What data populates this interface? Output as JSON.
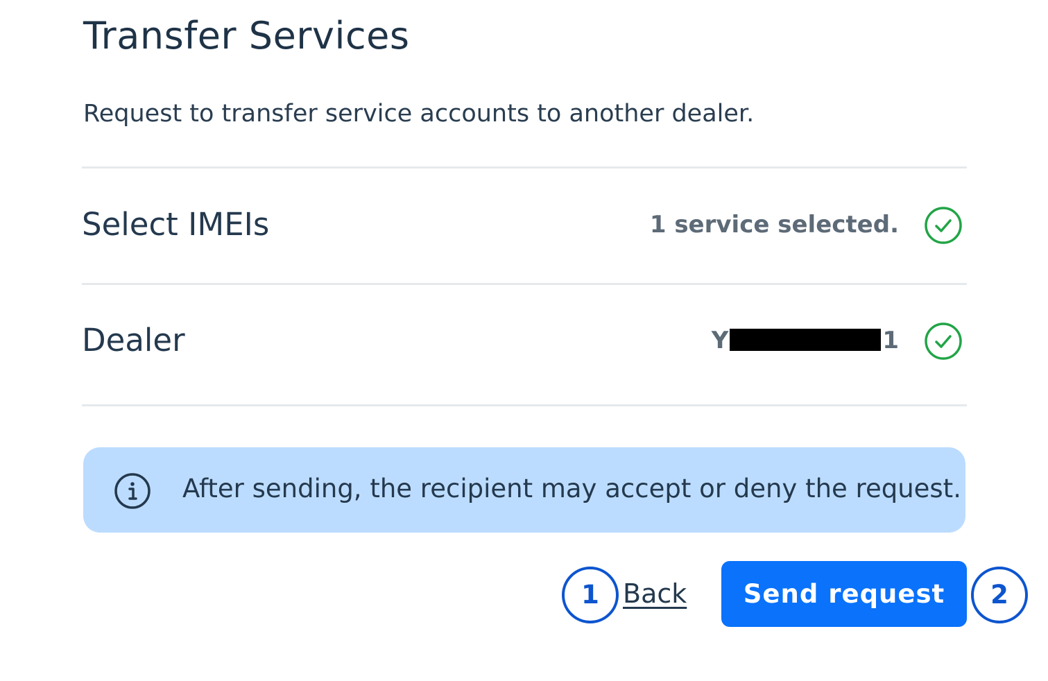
{
  "header": {
    "title": "Transfer Services",
    "subtitle": "Request to transfer service accounts to another dealer."
  },
  "rows": [
    {
      "label": "Select IMEIs",
      "value": "1 service selected.",
      "status_icon": "check-circle-icon",
      "status_color": "#22a447"
    },
    {
      "label": "Dealer",
      "value_prefix": "Y",
      "value_suffix": "1",
      "value_redacted": true,
      "status_icon": "check-circle-icon",
      "status_color": "#22a447"
    }
  ],
  "info_banner": {
    "icon": "info-icon",
    "text": "After sending, the recipient may accept or deny the request.",
    "background": "#bcdcff"
  },
  "actions": {
    "back_label": "Back",
    "send_label": "Send request",
    "send_color": "#0a72fb"
  },
  "annotations": [
    {
      "number": "1",
      "target": "back-link"
    },
    {
      "number": "2",
      "target": "send-request-button"
    }
  ]
}
